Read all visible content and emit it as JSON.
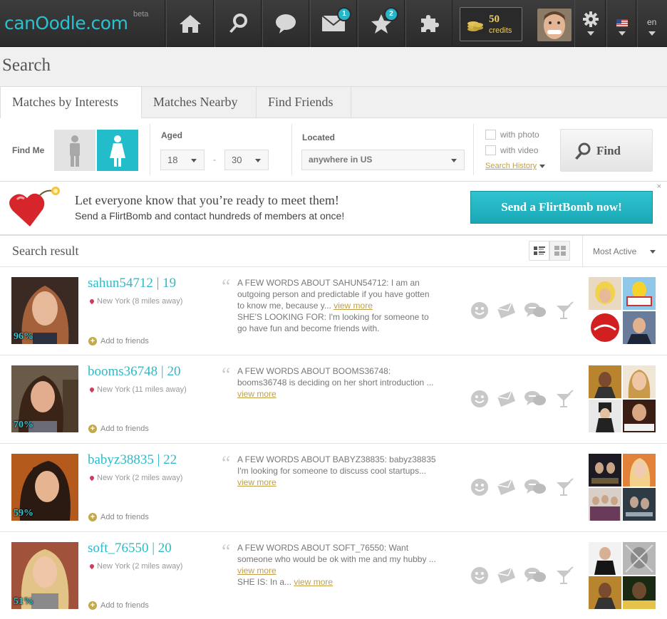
{
  "brand": {
    "logo": "canOodle.com",
    "beta": "beta"
  },
  "nav": {
    "messages_badge": "1",
    "favorites_badge": "2",
    "credits_count": "50",
    "credits_label": "credits",
    "language": "en"
  },
  "page_title": "Search",
  "tabs": [
    {
      "label": "Matches by Interests",
      "active": true
    },
    {
      "label": "Matches Nearby",
      "active": false
    },
    {
      "label": "Find Friends",
      "active": false
    }
  ],
  "filters": {
    "find_me_label": "Find Me",
    "aged_label": "Aged",
    "age_from": "18",
    "age_sep": "-",
    "age_to": "30",
    "located_label": "Located",
    "location_value": "anywhere in US",
    "with_photo": "with photo",
    "with_video": "with video",
    "search_history": "Search History",
    "find_button": "Find"
  },
  "flirtbomb": {
    "headline": "Let everyone know that you’re ready to meet them!",
    "subline": "Send a FlirtBomb and contact hundreds of members at once!",
    "button": "Send a FlirtBomb now!",
    "close": "×"
  },
  "results": {
    "title": "Search result",
    "sort_value": "Most Active",
    "add_friends_label": "Add to friends",
    "items": [
      {
        "username": "sahun54712 | 19",
        "location": "New York (8 miles away)",
        "match": "96%",
        "about_1": "A FEW WORDS ABOUT SAHUN54712: I am an outgoing person and predictable if you have gotten to know me, because y... ",
        "link_1": "view more",
        "about_2": "SHE'S LOOKING FOR: I'm looking for someone to go have fun and become friends with.",
        "link_2": ""
      },
      {
        "username": "booms36748 | 20",
        "location": "New York (11 miles away)",
        "match": "70%",
        "about_1": "A FEW WORDS ABOUT BOOMS36748: booms36748 is deciding on her short introduction ... ",
        "link_1": "view more",
        "about_2": "",
        "link_2": ""
      },
      {
        "username": "babyz38835 | 22",
        "location": "New York (2 miles away)",
        "match": "59%",
        "about_1": "A FEW WORDS ABOUT BABYZ38835: babyz38835 I'm looking for someone to discuss cool startups... ",
        "link_1": "view more",
        "about_2": "",
        "link_2": ""
      },
      {
        "username": "soft_76550 | 20",
        "location": "New York (2 miles away)",
        "match": "51%",
        "about_1": "A FEW WORDS ABOUT SOFT_76550: Want someone who would be ok with me and my hubby ... ",
        "link_1": "view more",
        "about_2": "SHE IS: In a... ",
        "link_2": "view more"
      }
    ]
  },
  "colors": {
    "accent": "#2fb9c9",
    "link_gold": "#c09f47",
    "topbar": "#333333"
  }
}
